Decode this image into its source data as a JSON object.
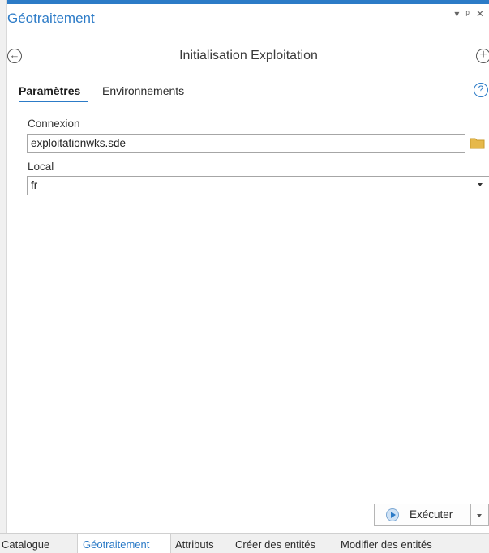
{
  "pane": {
    "title": "Géotraitement",
    "controls": [
      "▾",
      "ᵖ",
      "✕"
    ]
  },
  "tool": {
    "title": "Initialisation Exploitation"
  },
  "tabs": {
    "parameters": "Paramètres",
    "environments": "Environnements"
  },
  "params": {
    "connection_label": "Connexion",
    "connection_value": "exploitationwks.sde",
    "local_label": "Local",
    "local_value": "fr"
  },
  "run_button": {
    "label": "Exécuter"
  },
  "bottom_tabs": [
    "Catalogue",
    "Géotraitement",
    "Attributs",
    "Créer des entités",
    "Modifier des entités"
  ],
  "colors": {
    "accent": "#2c7bc7",
    "folder": "#e6b84a"
  },
  "icons": [
    "back-arrow-icon",
    "add-circle-icon",
    "help-icon",
    "folder-icon",
    "play-icon",
    "chevron-down-icon"
  ]
}
